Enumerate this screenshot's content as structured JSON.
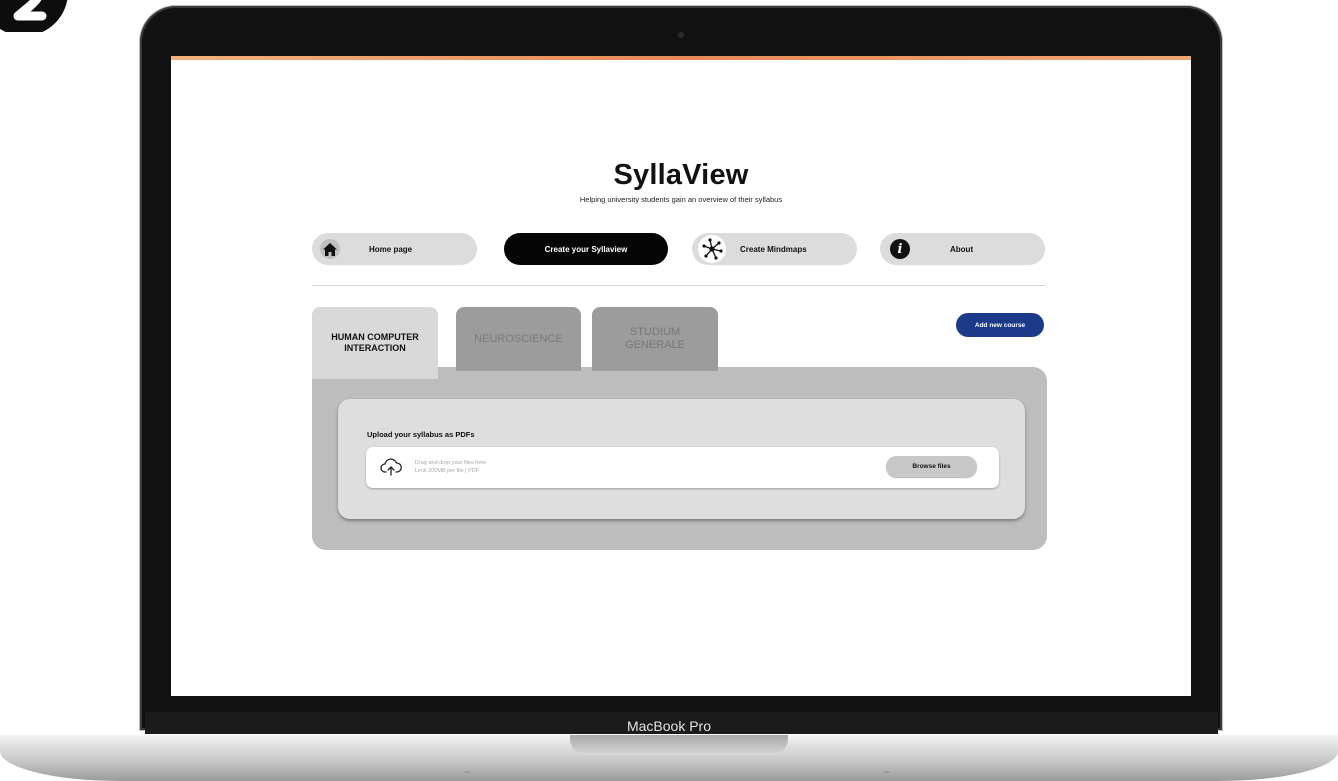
{
  "device": {
    "model_label": "MacBook Pro"
  },
  "app": {
    "title": "SyllaView",
    "subtitle": "Helping university students gain an overview of their syllabus"
  },
  "nav": {
    "home": "Home page",
    "create": "Create your Syllaview",
    "mindmaps": "Create Mindmaps",
    "about": "About"
  },
  "tabs": {
    "hci": "HUMAN COMPUTER INTERACTION",
    "neuro": "NEUROSCIENCE",
    "studium": "STUDIUM GENERALE"
  },
  "add_course": "Add new course",
  "upload": {
    "heading": "Upload your syllabus as PDFs",
    "drop_text": "Drag and drop your files here",
    "limit_text": "Limit 200MB per file | PDF",
    "browse": "Browse files"
  },
  "colors": {
    "accent": "#1d3a8a",
    "primary_button": "#050505",
    "top_bar": "#e88a55",
    "nav_button": "#dcdcdc",
    "panel": "#bdbdbd"
  },
  "icons": {
    "step": "step-2-badge-icon",
    "home": "home-icon",
    "mindmaps": "network-icon",
    "about": "info-icon",
    "upload": "cloud-upload-icon"
  }
}
